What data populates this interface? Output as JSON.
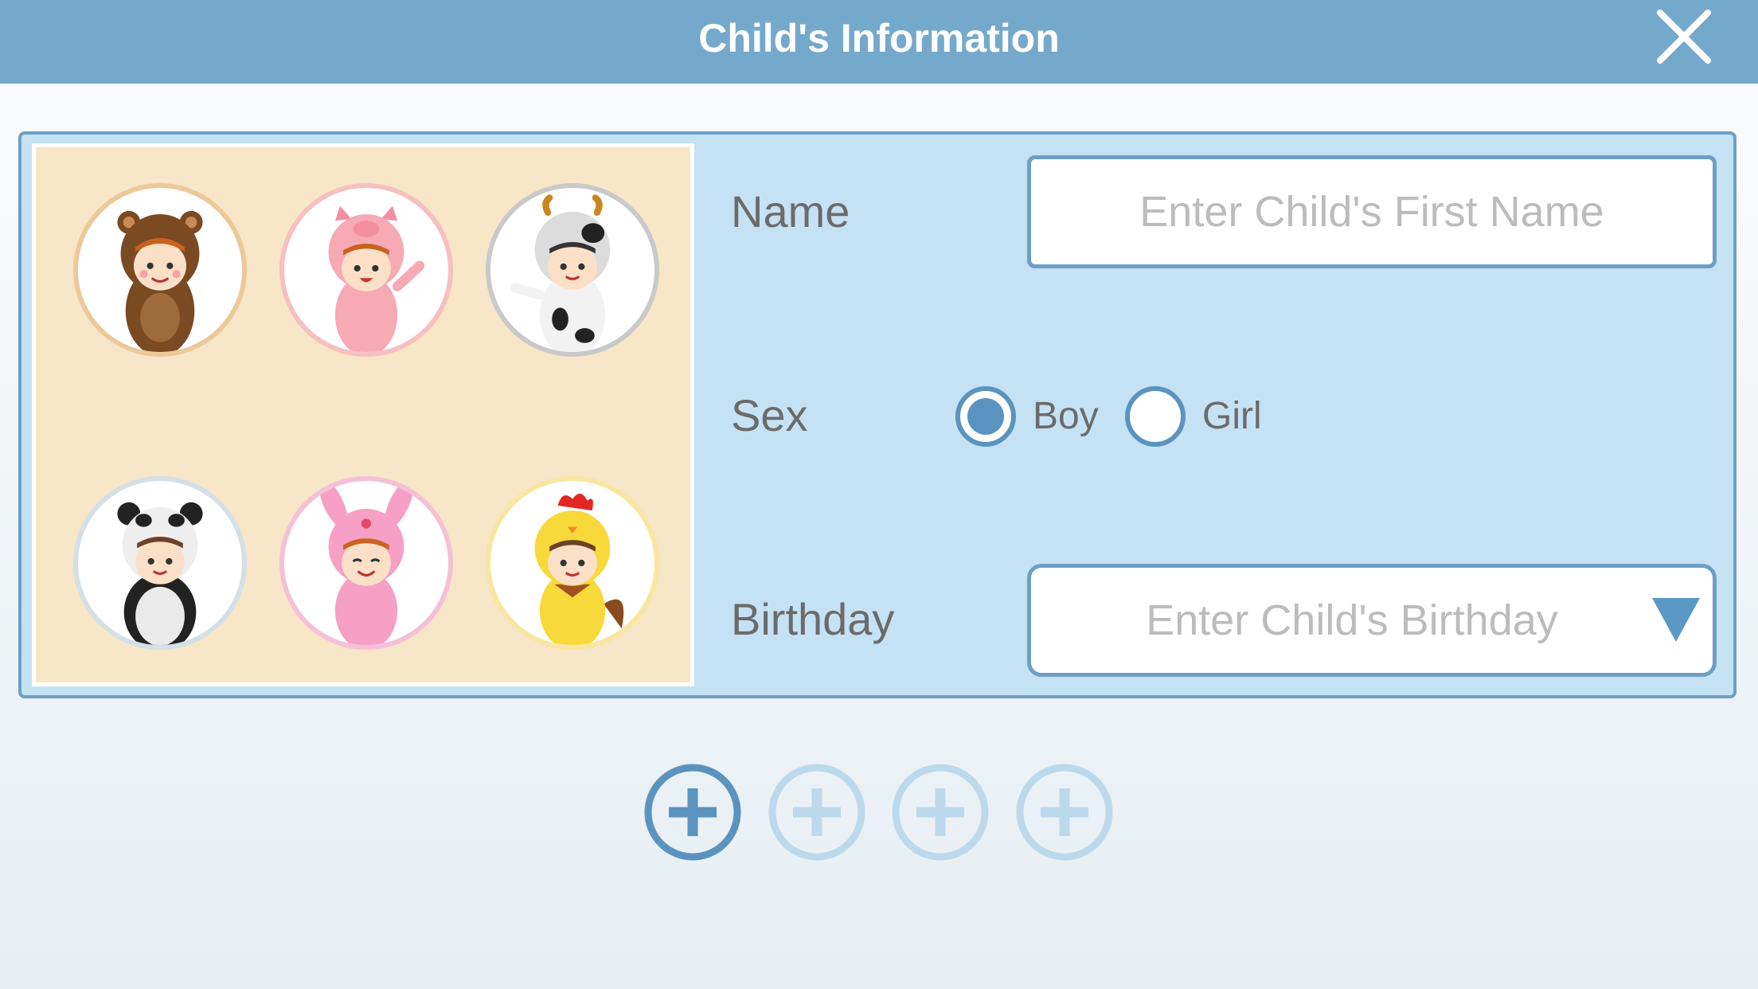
{
  "header": {
    "title": "Child's Information",
    "close_icon": "close-icon"
  },
  "avatars": [
    {
      "animal": "bear",
      "icon": "bear-costume-avatar-icon"
    },
    {
      "animal": "pig",
      "icon": "pig-costume-avatar-icon"
    },
    {
      "animal": "cow",
      "icon": "cow-costume-avatar-icon"
    },
    {
      "animal": "panda",
      "icon": "panda-costume-avatar-icon"
    },
    {
      "animal": "rabbit",
      "icon": "rabbit-costume-avatar-icon"
    },
    {
      "animal": "rooster",
      "icon": "rooster-costume-avatar-icon"
    }
  ],
  "form": {
    "name_label": "Name",
    "name_placeholder": "Enter Child's First Name",
    "name_value": "",
    "sex_label": "Sex",
    "sex_options": [
      {
        "label": "Boy",
        "selected": true
      },
      {
        "label": "Girl",
        "selected": false
      }
    ],
    "birthday_label": "Birthday",
    "birthday_placeholder": "Enter Child's Birthday",
    "birthday_caret_icon": "caret-down-icon"
  },
  "add_child_slots": [
    {
      "icon": "plus-circle-icon",
      "active": true
    },
    {
      "icon": "plus-circle-icon",
      "active": false
    },
    {
      "icon": "plus-circle-icon",
      "active": false
    },
    {
      "icon": "plus-circle-icon",
      "active": false
    }
  ],
  "colors": {
    "header": "#75a9cc",
    "card": "#c5e2f5",
    "border": "#6d9fc5",
    "avatar_panel": "#f7e6c7",
    "accent": "#5a93bf"
  }
}
